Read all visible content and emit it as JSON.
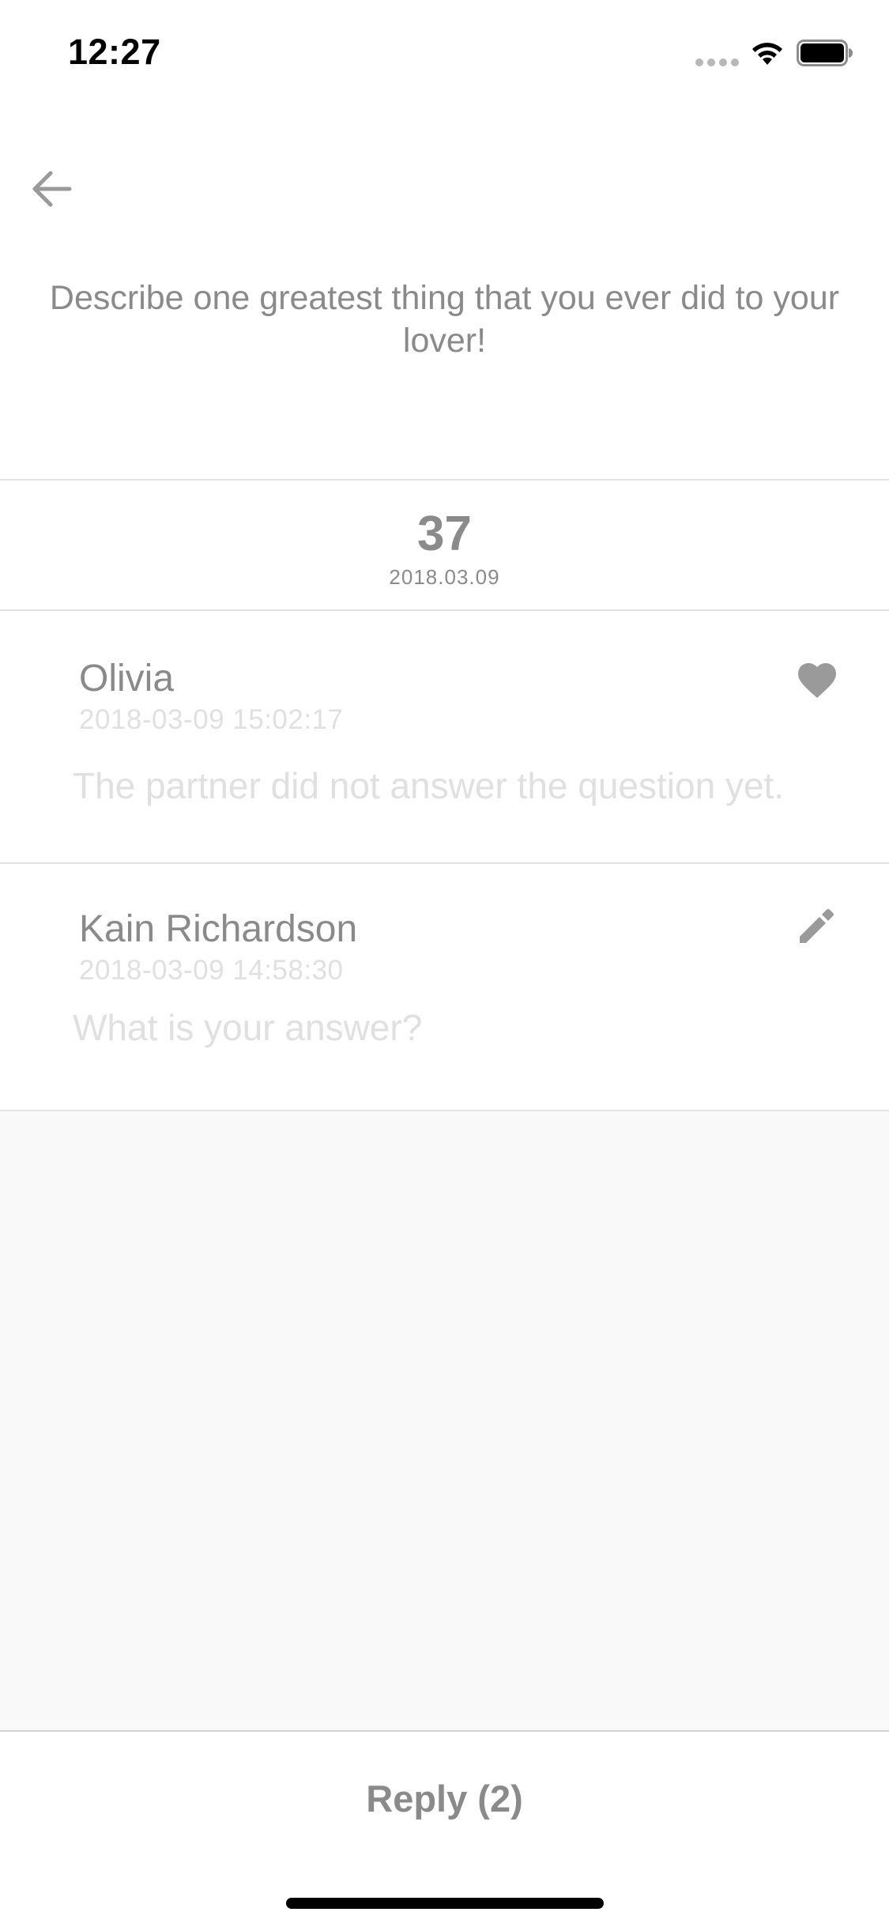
{
  "status_bar": {
    "time": "12:27"
  },
  "question": {
    "text": "Describe one greatest thing that you ever did to your lover!"
  },
  "day": {
    "number": "37",
    "date": "2018.03.09"
  },
  "answers": [
    {
      "name": "Olivia",
      "timestamp": "2018-03-09 15:02:17",
      "text": "The partner did not answer the question yet.",
      "action_icon": "heart-icon"
    },
    {
      "name": "Kain Richardson",
      "timestamp": "2018-03-09 14:58:30",
      "text": "What is your answer?",
      "action_icon": "edit-pencil-icon"
    }
  ],
  "footer": {
    "reply_label": "Reply (2)"
  },
  "colors": {
    "text_primary": "#8a8a8a",
    "text_faint": "#e0e0e0",
    "divider": "#e4e4e4",
    "background_empty": "#f9f9f9"
  }
}
